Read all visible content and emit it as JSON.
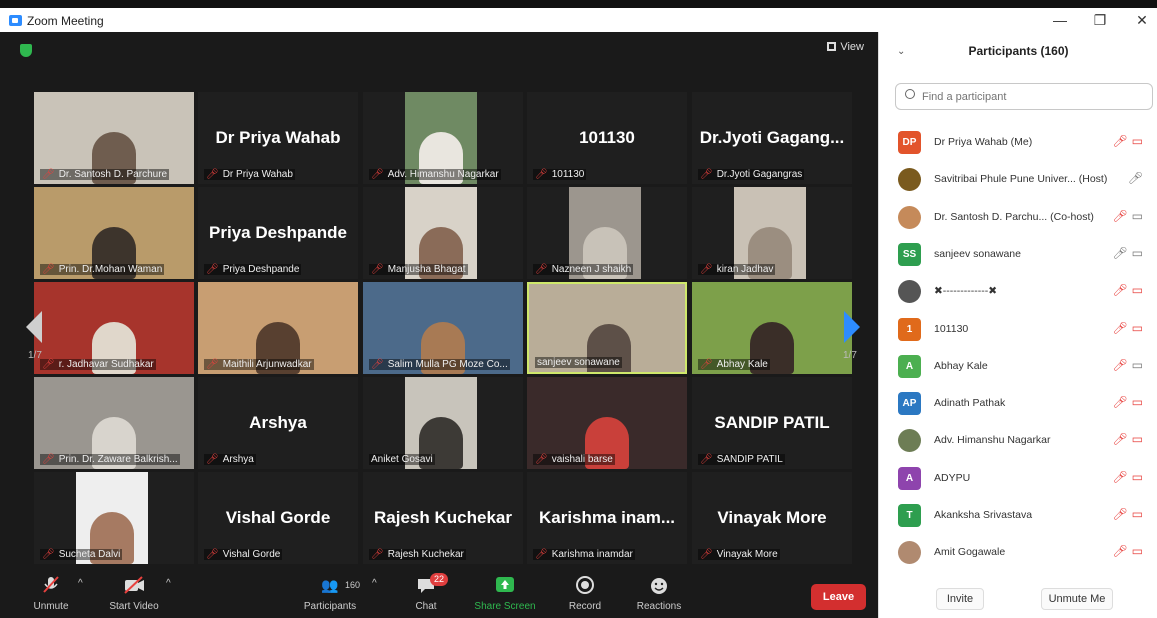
{
  "window": {
    "title": "Zoom Meeting",
    "minimize": "—",
    "restore": "❐",
    "close": "✕"
  },
  "meeting": {
    "view_label": "View",
    "page_left": "1/7",
    "page_right": "1/7",
    "tiles": [
      {
        "big": "",
        "label": "Dr. Santosh D. Parchure",
        "video": true
      },
      {
        "big": "Dr Priya Wahab",
        "label": "Dr Priya Wahab",
        "video": false
      },
      {
        "big": "",
        "label": "Adv. Himanshu Nagarkar",
        "video": true
      },
      {
        "big": "101130",
        "label": "101130",
        "video": false
      },
      {
        "big": "Dr.Jyoti Gagang...",
        "label": "Dr.Jyoti Gagangras",
        "video": false
      },
      {
        "big": "",
        "label": "Prin. Dr.Mohan Waman",
        "video": true
      },
      {
        "big": "Priya Deshpande",
        "label": "Priya Deshpande",
        "video": false
      },
      {
        "big": "",
        "label": "Manjusha Bhagat",
        "video": true
      },
      {
        "big": "",
        "label": "Nazneen J shaikh",
        "video": true
      },
      {
        "big": "",
        "label": "kiran Jadhav",
        "video": true
      },
      {
        "big": "",
        "label": "r. Jadhavar Sudhakar",
        "video": true
      },
      {
        "big": "",
        "label": "Maithili Arjunwadkar",
        "video": true
      },
      {
        "big": "",
        "label": "Salim Mulla PG Moze Co...",
        "video": true
      },
      {
        "big": "",
        "label": "sanjeev sonawane",
        "video": true
      },
      {
        "big": "",
        "label": "Abhay Kale",
        "video": true
      },
      {
        "big": "",
        "label": "Prin. Dr. Zaware Balkrish...",
        "video": true
      },
      {
        "big": "Arshya",
        "label": "Arshya",
        "video": false
      },
      {
        "big": "",
        "label": "Aniket Gosavi",
        "video": true
      },
      {
        "big": "",
        "label": "vaishali barse",
        "video": true
      },
      {
        "big": "SANDIP PATIL",
        "label": "SANDIP PATIL",
        "video": false
      },
      {
        "big": "",
        "label": "Sucheta Dalvi",
        "video": true
      },
      {
        "big": "Vishal Gorde",
        "label": "Vishal Gorde",
        "video": false
      },
      {
        "big": "Rajesh Kuchekar",
        "label": "Rajesh Kuchekar",
        "video": false
      },
      {
        "big": "Karishma inam...",
        "label": "Karishma inamdar",
        "video": false
      },
      {
        "big": "Vinayak More",
        "label": "Vinayak More",
        "video": false
      }
    ]
  },
  "toolbar": {
    "unmute": "Unmute",
    "start_video": "Start Video",
    "participants": "Participants",
    "participants_count": "160",
    "chat": "Chat",
    "chat_badge": "22",
    "share_screen": "Share Screen",
    "record": "Record",
    "reactions": "Reactions",
    "leave": "Leave"
  },
  "panel": {
    "title": "Participants (160)",
    "search_placeholder": "Find a participant",
    "invite": "Invite",
    "unmute_me": "Unmute Me",
    "participants": [
      {
        "initials": "DP",
        "color": "#e2542b",
        "name": "Dr Priya Wahab (Me)",
        "mic": "off",
        "video": "off"
      },
      {
        "initials": "",
        "color": "#7a5a1e",
        "name": "Savitribai Phule Pune Univer... (Host)",
        "mic": "on",
        "video": "none"
      },
      {
        "initials": "",
        "color": "#c58a5a",
        "name": "Dr. Santosh D. Parchu... (Co-host)",
        "mic": "off",
        "video": "on"
      },
      {
        "initials": "SS",
        "color": "#2e9e4f",
        "name": "sanjeev sonawane",
        "mic": "on",
        "video": "on"
      },
      {
        "initials": "",
        "color": "#555555",
        "name": "✖-------------✖",
        "mic": "off",
        "video": "off"
      },
      {
        "initials": "1",
        "color": "#e06a1b",
        "name": "101130",
        "mic": "off",
        "video": "off"
      },
      {
        "initials": "A",
        "color": "#4caf50",
        "name": "Abhay Kale",
        "mic": "off",
        "video": "on"
      },
      {
        "initials": "AP",
        "color": "#2b78c2",
        "name": "Adinath Pathak",
        "mic": "off",
        "video": "off"
      },
      {
        "initials": "",
        "color": "#6d7d55",
        "name": "Adv. Himanshu Nagarkar",
        "mic": "off",
        "video": "off"
      },
      {
        "initials": "A",
        "color": "#8e44ad",
        "name": "ADYPU",
        "mic": "off",
        "video": "off"
      },
      {
        "initials": "T",
        "color": "#2e9e4f",
        "name": "Akanksha Srivastava",
        "mic": "off",
        "video": "off"
      },
      {
        "initials": "",
        "color": "#b08a70",
        "name": "Amit Gogawale",
        "mic": "off",
        "video": "off"
      }
    ]
  }
}
